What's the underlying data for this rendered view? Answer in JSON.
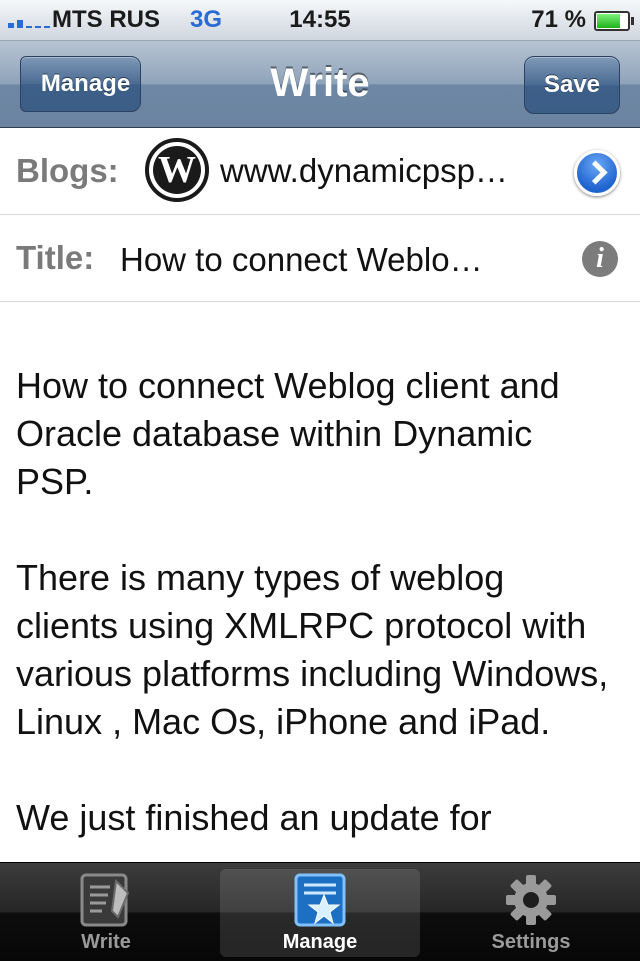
{
  "status_bar": {
    "carrier": "MTS RUS",
    "network": "3G",
    "time": "14:55",
    "battery_text": "71 %",
    "battery_level": 0.71
  },
  "nav": {
    "back_label": "Manage",
    "title": "Write",
    "save_label": "Save"
  },
  "form": {
    "blogs_label": "Blogs:",
    "blog_url": "www.dynamicpsp…",
    "title_label": "Title:",
    "title_value": "How to connect Weblo…"
  },
  "content": {
    "paragraphs": [
      "How to connect Weblog client and Oracle database within Dynamic PSP.",
      "There is many types of weblog clients using XMLRPC protocol with various platforms including Windows, Linux , Mac Os, iPhone and iPad.",
      "We just finished an update for"
    ]
  },
  "tabs": [
    {
      "label": "Write",
      "icon": "write-icon"
    },
    {
      "label": "Manage",
      "icon": "manage-star-icon"
    },
    {
      "label": "Settings",
      "icon": "gear-icon"
    }
  ],
  "colors": {
    "nav_bar": "#6d87a4",
    "disclosure": "#1f63cf",
    "tab_active": "#ffffff",
    "tab_inactive": "#9a9a9a"
  }
}
